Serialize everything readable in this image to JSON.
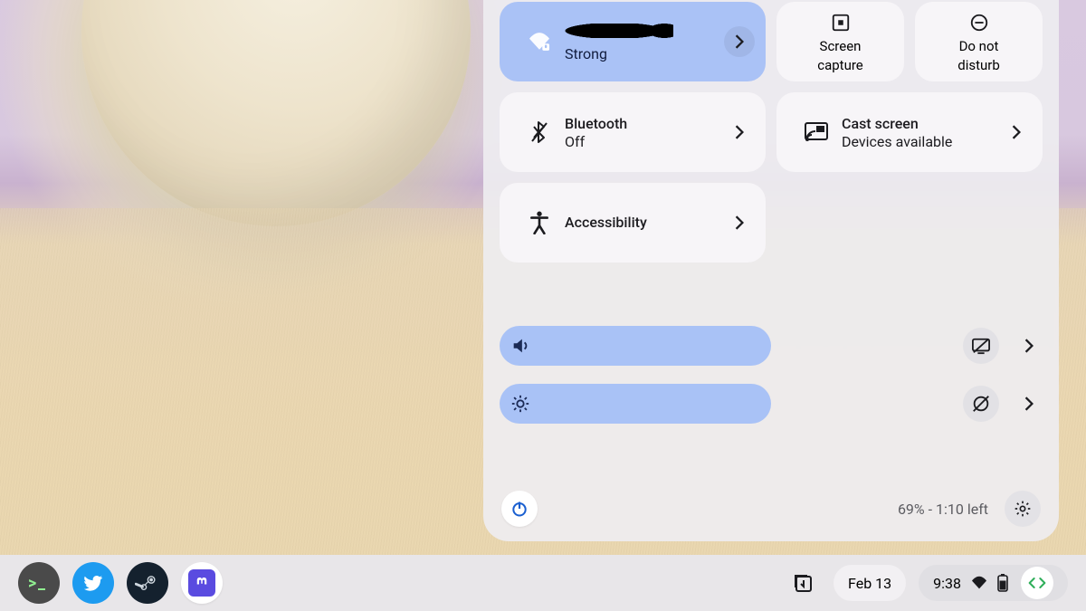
{
  "panel": {
    "wifi": {
      "title_redacted": true,
      "subtitle": "Strong"
    },
    "screen_capture": {
      "line1": "Screen",
      "line2": "capture"
    },
    "dnd": {
      "line1": "Do not",
      "line2": "disturb"
    },
    "bluetooth": {
      "title": "Bluetooth",
      "subtitle": "Off"
    },
    "cast": {
      "title": "Cast screen",
      "subtitle": "Devices available"
    },
    "accessibility": {
      "title": "Accessibility"
    },
    "battery": "69% - 1:10 left",
    "sliders": {
      "volume_pct": 50,
      "brightness_pct": 50
    }
  },
  "shelf": {
    "date": "Feb 13",
    "time": "9:38"
  }
}
